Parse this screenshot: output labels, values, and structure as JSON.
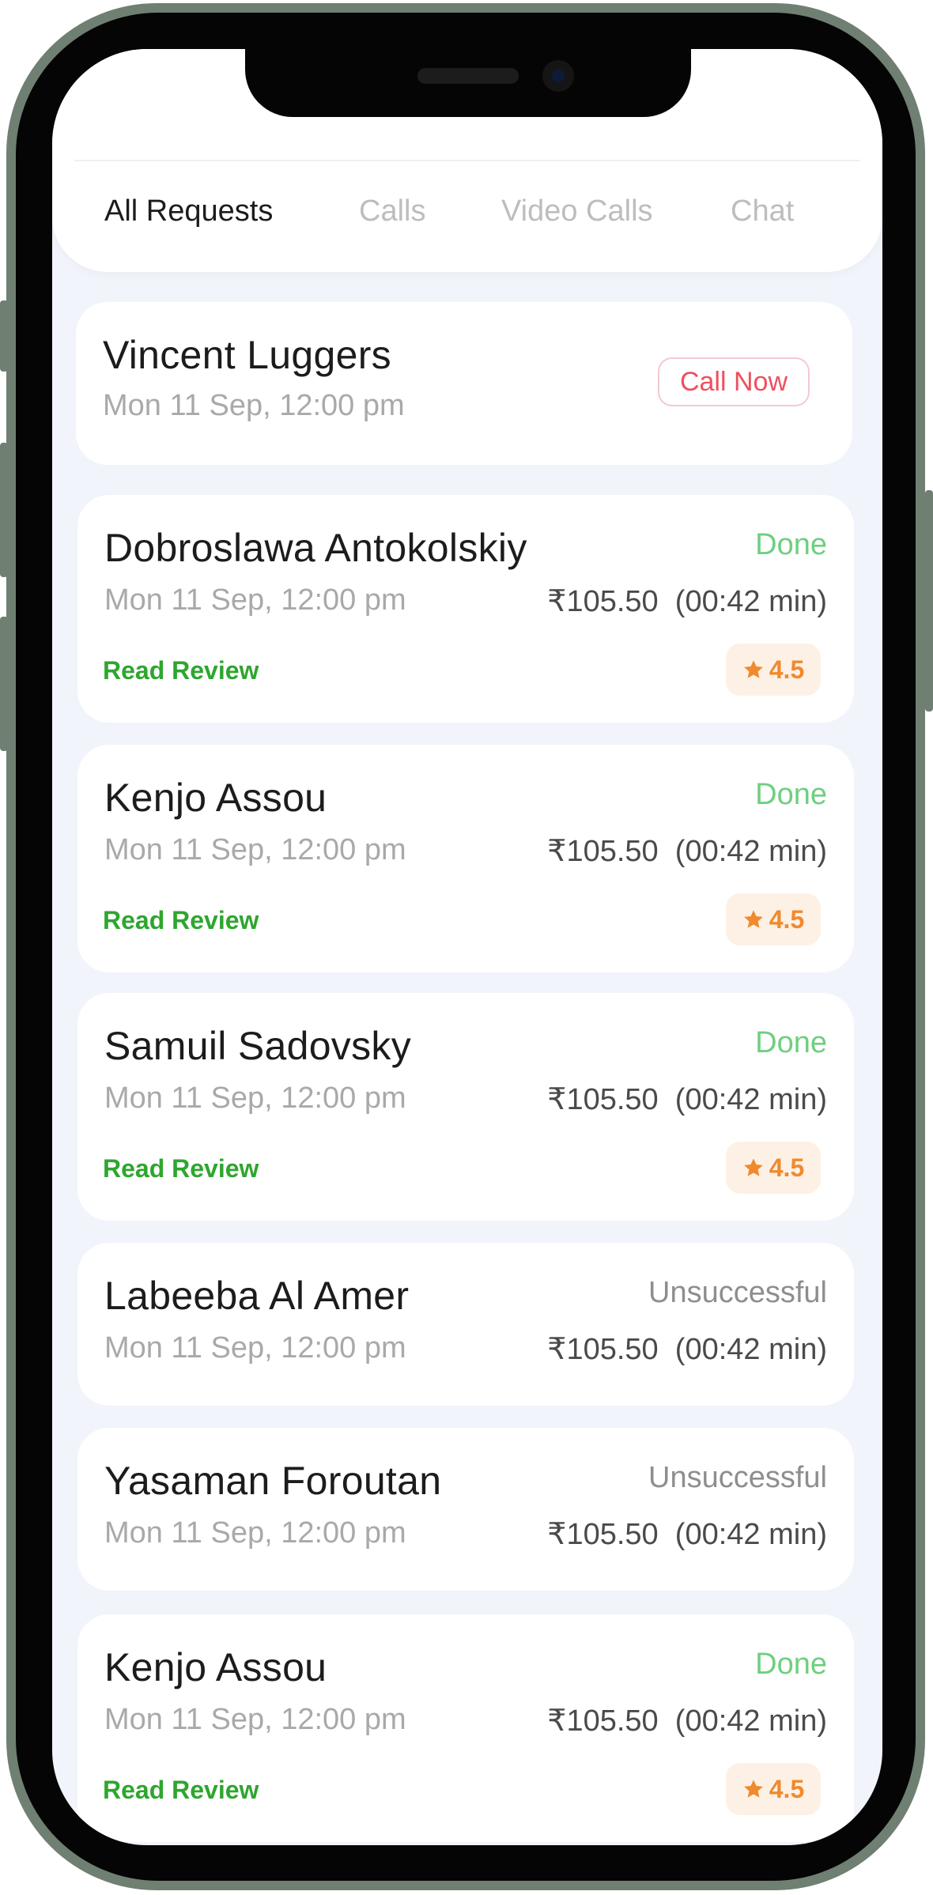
{
  "tabs": [
    {
      "label": "All Requests",
      "active": true
    },
    {
      "label": "Calls",
      "active": false
    },
    {
      "label": "Video Calls",
      "active": false
    },
    {
      "label": "Chat",
      "active": false
    }
  ],
  "pending": {
    "name": "Vincent Luggers",
    "date": "Mon 11 Sep, 12:00 pm",
    "action_label": "Call Now"
  },
  "requests": [
    {
      "name": "Dobroslawa Antokolskiy",
      "date": "Mon 11 Sep, 12:00 pm",
      "status": "Done",
      "price": "₹105.50  (00:42 min)",
      "review_label": "Read Review",
      "rating": "4.5"
    },
    {
      "name": "Kenjo Assou",
      "date": "Mon 11 Sep, 12:00 pm",
      "status": "Done",
      "price": "₹105.50  (00:42 min)",
      "review_label": "Read Review",
      "rating": "4.5"
    },
    {
      "name": "Samuil Sadovsky",
      "date": "Mon 11 Sep, 12:00 pm",
      "status": "Done",
      "price": "₹105.50  (00:42 min)",
      "review_label": "Read Review",
      "rating": "4.5"
    },
    {
      "name": "Labeeba Al Amer",
      "date": "Mon 11 Sep, 12:00 pm",
      "status": "Unsuccessful",
      "price": "₹105.50  (00:42 min)"
    },
    {
      "name": "Yasaman Foroutan",
      "date": "Mon 11 Sep, 12:00 pm",
      "status": "Unsuccessful",
      "price": "₹105.50  (00:42 min)"
    },
    {
      "name": "Kenjo Assou",
      "date": "Mon 11 Sep, 12:00 pm",
      "status": "Done",
      "price": "₹105.50  (00:42 min)",
      "review_label": "Read Review",
      "rating": "4.5"
    }
  ],
  "colors": {
    "done": "#6fcf7f",
    "unsuccessful": "#8e8e8e",
    "review": "#2ea62e",
    "rating": "#f08a2e",
    "call_now": "#ef4f5e",
    "background": "#f1f4fa"
  },
  "icons": {
    "rating": "star-icon"
  }
}
